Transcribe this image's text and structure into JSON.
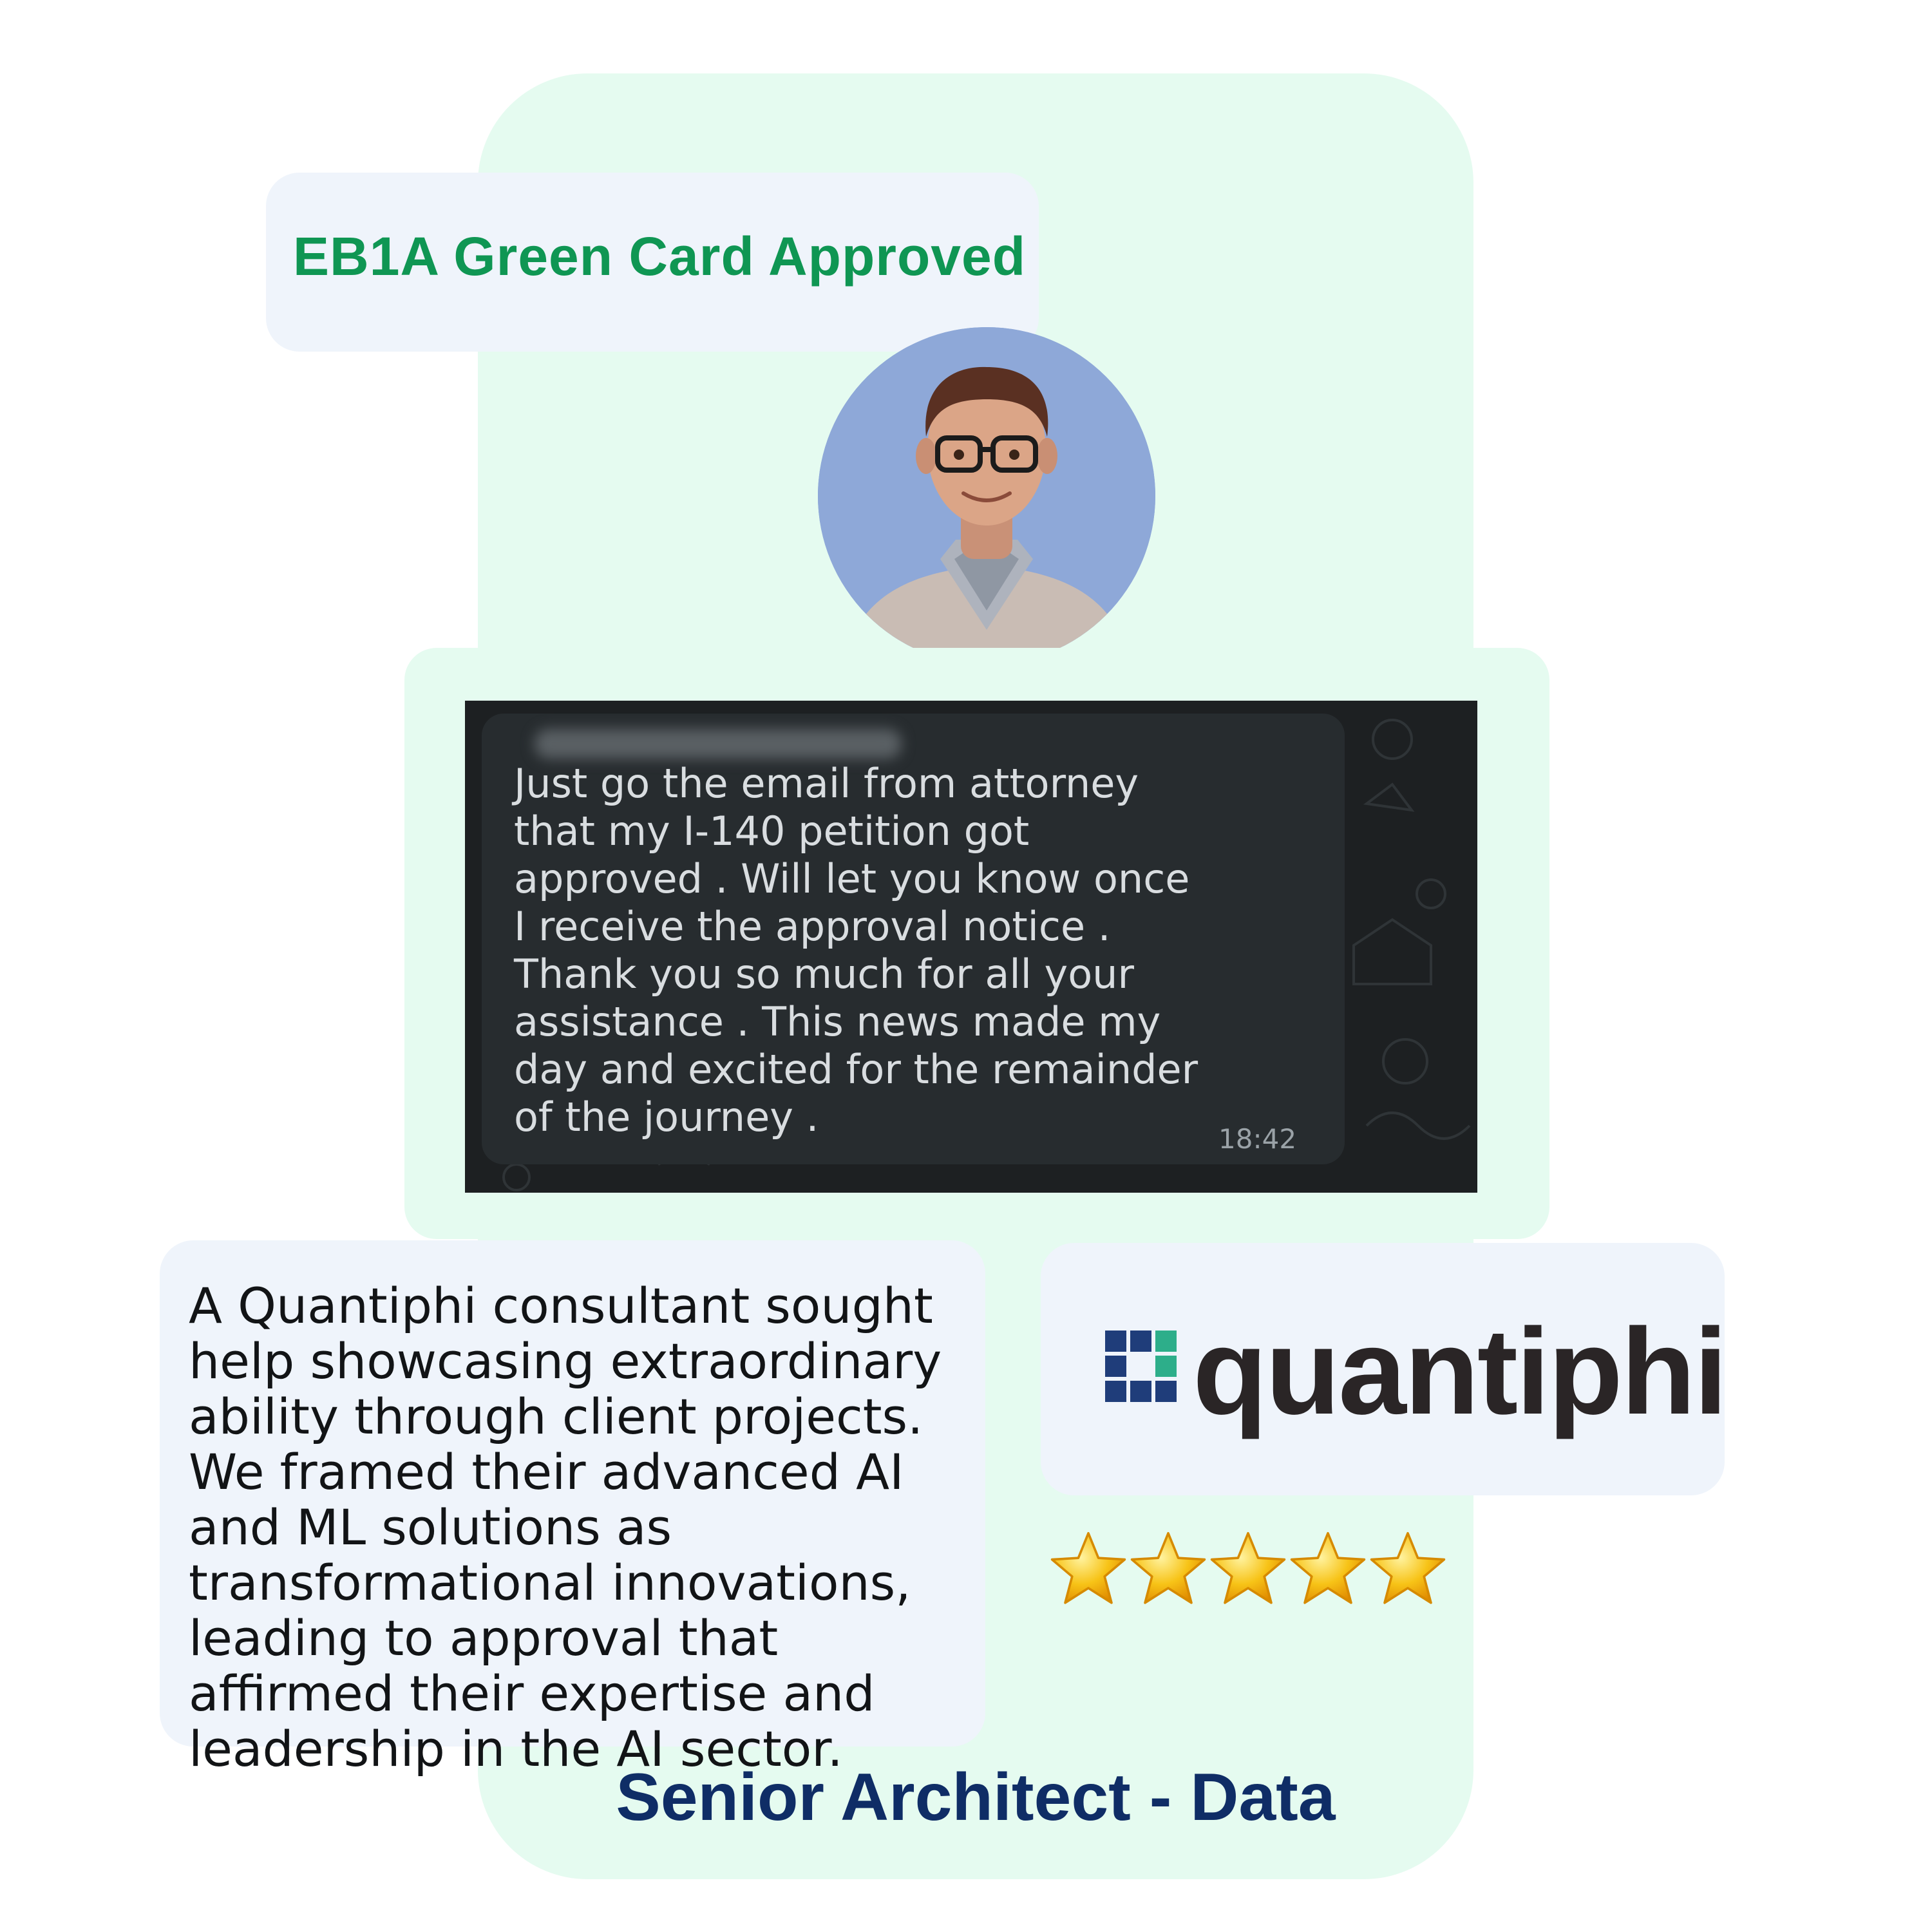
{
  "badge": {
    "title": "EB1A Green Card Approved"
  },
  "chat": {
    "message": "Just go the email from attorney\nthat my I-140 petition got\napproved . Will let you know once\nI receive the approval notice .\nThank you so much for all your\nassistance . This news made my\nday and excited for the remainder\nof the journey .",
    "time": "18:42"
  },
  "description": "A Quantiphi consultant sought help showcasing extraordinary ability through client projects. We framed their advanced AI and ML solutions as transformational innovations, leading to approval that affirmed their expertise and leadership in the AI sector.",
  "company": {
    "logo_text": "quantiphi"
  },
  "rating": {
    "stars": 5,
    "max": 5
  },
  "role": "Senior Architect - Data",
  "colors": {
    "title_green": "#0f9653",
    "role_navy": "#0f2d66",
    "card_mint": "#e5fbf0",
    "card_blue": "#eff4fb"
  }
}
